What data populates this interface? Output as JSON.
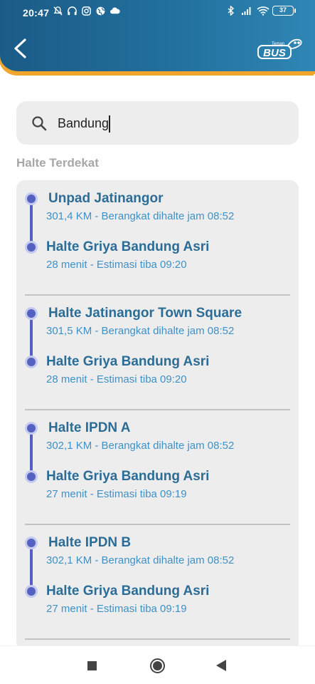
{
  "status_bar": {
    "time": "20:47",
    "battery": "37",
    "left_icons": [
      "bell-off-icon",
      "headset-icon",
      "instagram-icon",
      "globe-icon",
      "cloud-icon"
    ],
    "right_icons": [
      "bluetooth-icon",
      "signal-icon",
      "wifi-icon",
      "battery-icon"
    ]
  },
  "header": {
    "logo_small": "Teman",
    "logo_main": "BUS",
    "brand_colors": {
      "primary": "#1b5b87",
      "accent": "#f0a52a"
    }
  },
  "search": {
    "value": "Bandung",
    "icon": "search-icon"
  },
  "section": {
    "title": "Halte Terdekat"
  },
  "routes": [
    {
      "from": "Unpad Jatinangor",
      "from_info": "301,4 KM - Berangkat dihalte jam 08:52",
      "to": "Halte Griya Bandung Asri",
      "to_info": "28 menit - Estimasi tiba 09:20"
    },
    {
      "from": "Halte Jatinangor Town Square",
      "from_info": "301,5 KM - Berangkat dihalte jam 08:52",
      "to": "Halte Griya Bandung Asri",
      "to_info": "28 menit - Estimasi tiba 09:20"
    },
    {
      "from": "Halte IPDN A",
      "from_info": "302,1 KM - Berangkat dihalte jam 08:52",
      "to": "Halte Griya Bandung Asri",
      "to_info": "27 menit - Estimasi tiba 09:19"
    },
    {
      "from": "Halte IPDN B",
      "from_info": "302,1 KM - Berangkat dihalte jam 08:52",
      "to": "Halte Griya Bandung Asri",
      "to_info": "27 menit - Estimasi tiba 09:19"
    }
  ]
}
